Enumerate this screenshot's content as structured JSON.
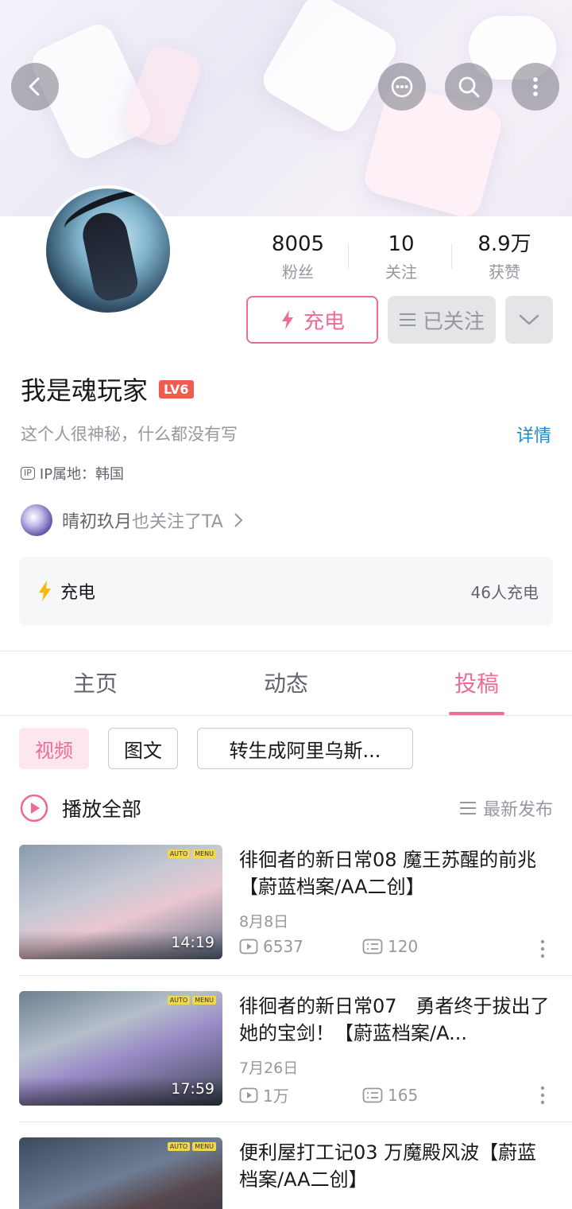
{
  "header": {
    "back_icon": "chevron-left-icon",
    "message_icon": "chat-bubble-icon",
    "search_icon": "search-icon",
    "more_icon": "vertical-dots-icon"
  },
  "profile": {
    "stats": [
      {
        "value": "8005",
        "label": "粉丝"
      },
      {
        "value": "10",
        "label": "关注"
      },
      {
        "value": "8.9万",
        "label": "获赞"
      }
    ],
    "charge_label": "充电",
    "follow_label": "已关注",
    "name": "我是魂玩家",
    "level": "LV6",
    "bio": "这个人很神秘，什么都没有写",
    "detail_label": "详情",
    "ip": "IP属地：韩国",
    "ip_badge": "IP",
    "mutual_name": "晴初玖月",
    "mutual_text": "也关注了TA"
  },
  "charge_panel": {
    "label": "充电",
    "count": "46人充电"
  },
  "tabs": [
    {
      "label": "主页",
      "active": false
    },
    {
      "label": "动态",
      "active": false
    },
    {
      "label": "投稿",
      "active": true
    }
  ],
  "chips": [
    {
      "label": "视频",
      "active": true
    },
    {
      "label": "图文",
      "active": false
    },
    {
      "label": "转生成阿里乌斯...",
      "active": false
    }
  ],
  "play_all": "播放全部",
  "sort": "最新发布",
  "videos": [
    {
      "title": "徘徊者的新日常08 魔王苏醒的前兆 【蔚蓝档案/AA二创】",
      "date": "8月8日",
      "views": "6537",
      "comments": "120",
      "duration": "14:19"
    },
    {
      "title": "徘徊者的新日常07　勇者终于拔出了她的宝剑！【蔚蓝档案/A...",
      "date": "7月26日",
      "views": "1万",
      "comments": "165",
      "duration": "17:59"
    },
    {
      "title": "便利屋打工记03 万魔殿风波【蔚蓝档案/AA二创】",
      "date": "",
      "views": "",
      "comments": "",
      "duration": ""
    }
  ],
  "colors": {
    "accent": "#ec6c97",
    "link": "#178bcf",
    "level_badge": "#ee5b4f",
    "muted": "#9499a0"
  }
}
